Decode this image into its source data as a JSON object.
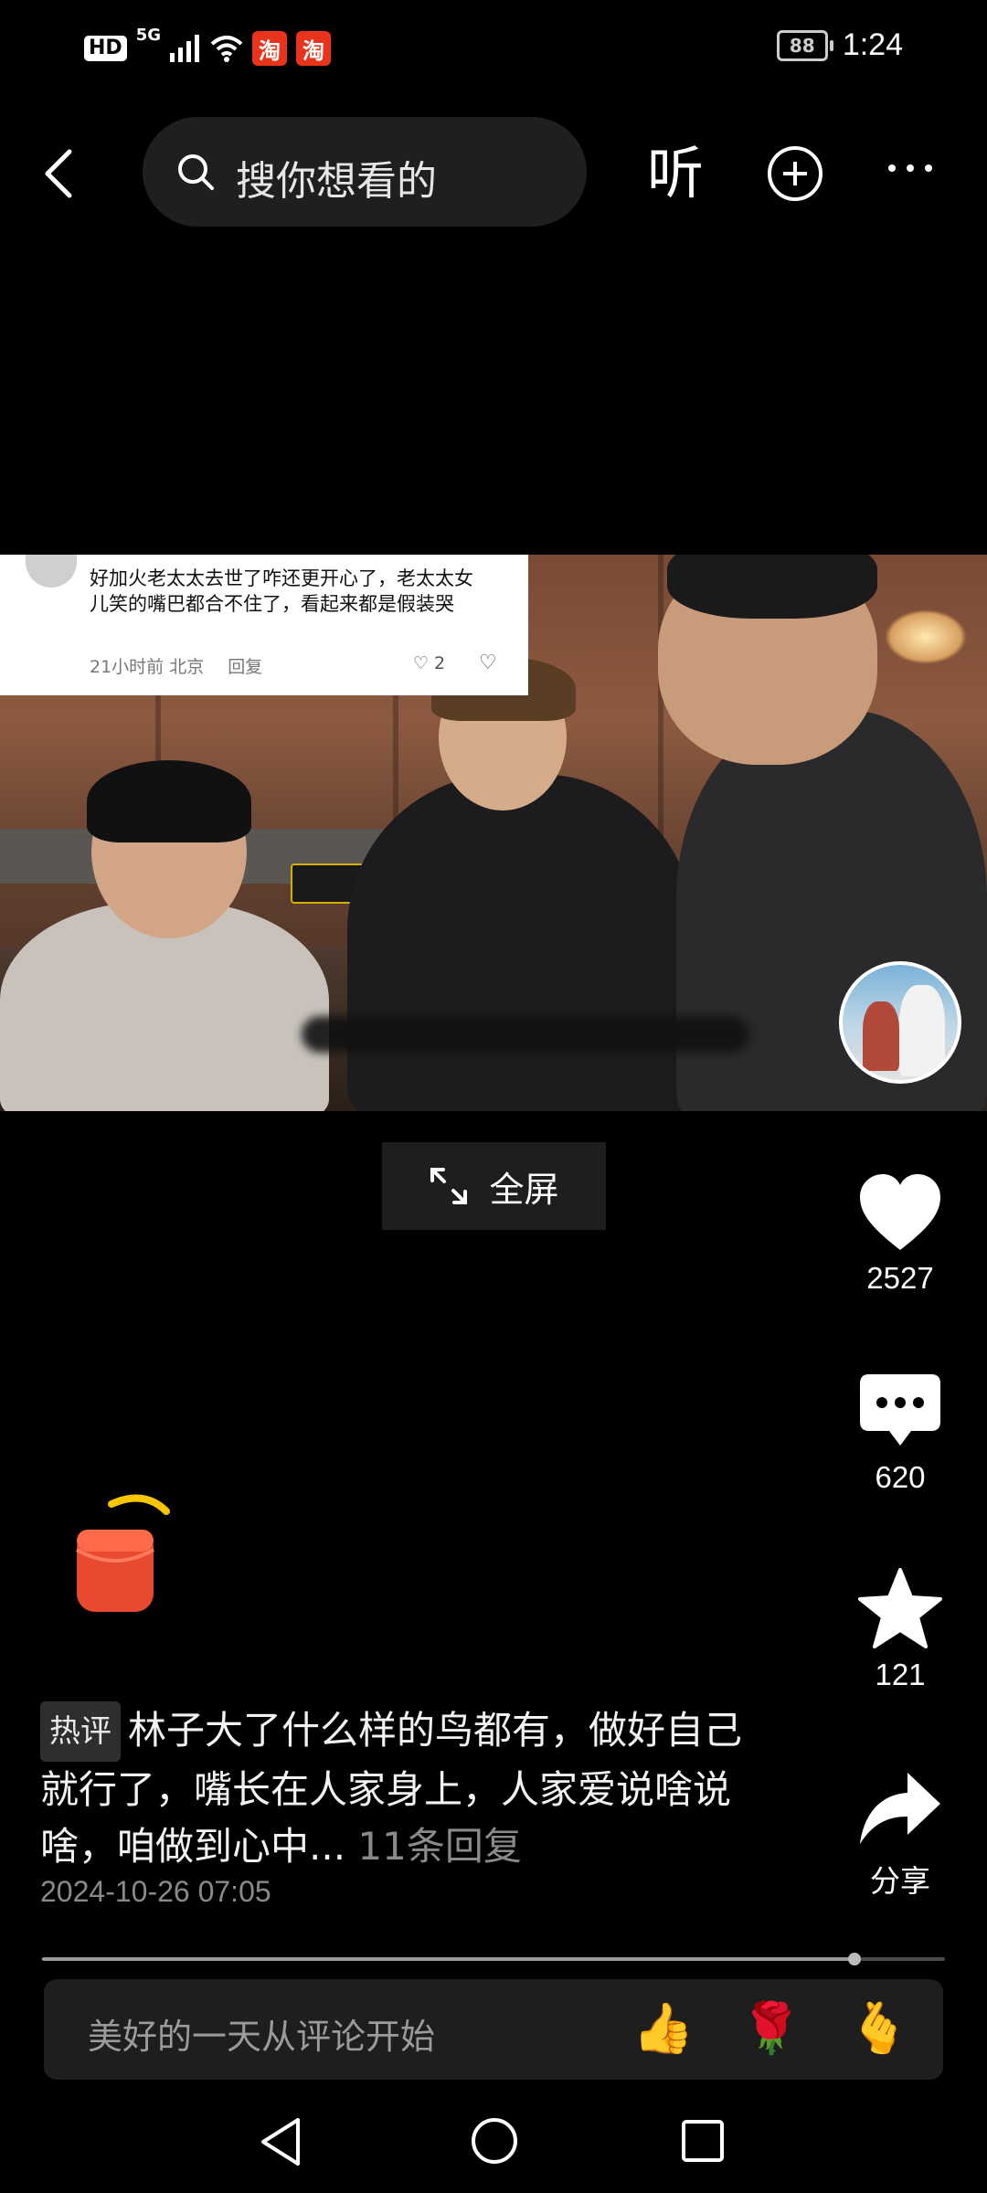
{
  "status_bar": {
    "hd": "HD",
    "network": "5G",
    "app_badge_1": "淘",
    "app_badge_2": "淘",
    "battery": "88",
    "time": "1:24"
  },
  "top_nav": {
    "search_placeholder": "搜你想看的",
    "listen_label": "听"
  },
  "video": {
    "overlay_comment": {
      "text": "好加火老太太去世了咋还更开心了，老太太女儿笑的嘴巴都合不住了，看起来都是假装哭",
      "time_location": "21小时前 北京",
      "reply_label": "回复",
      "like_count": "2"
    }
  },
  "fullscreen_label": "全屏",
  "actions": {
    "like_count": "2527",
    "comment_count": "620",
    "favorite_count": "121",
    "share_label": "分享"
  },
  "hot_comment": {
    "tag": "热评",
    "text": "林子大了什么样的鸟都有，做好自己就行了，嘴长在人家身上，人家爱说啥说啥，咱做到心中...",
    "replies": "11条回复",
    "date": "2024-10-26 07:05"
  },
  "progress": {
    "played_fraction": 0.9
  },
  "comment_input": {
    "placeholder": "美好的一天从评论开始",
    "emojis": [
      "👍",
      "🌹",
      "🫰"
    ]
  }
}
